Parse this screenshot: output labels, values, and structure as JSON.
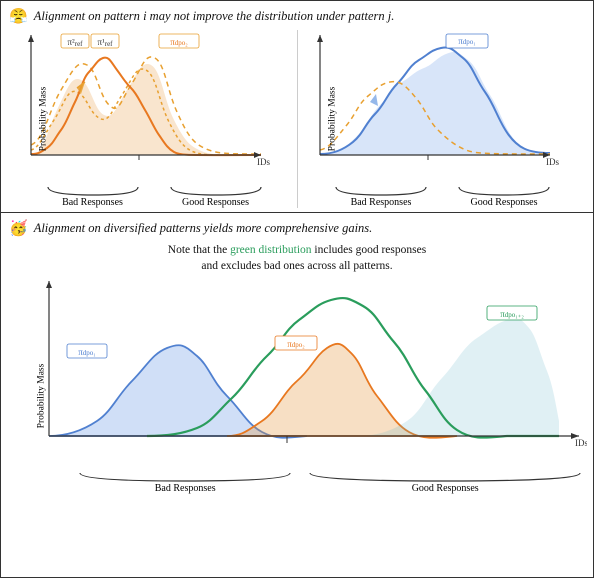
{
  "top_panel": {
    "title": "Alignment on pattern ",
    "title_i": "i",
    "title_mid": " may not improve the distribution under pattern ",
    "title_j": "j",
    "title_end": ".",
    "emoji": "😤"
  },
  "bottom_panel": {
    "title": "Alignment on diversified patterns yields more comprehensive gains.",
    "emoji": "🥳",
    "note_prefix": "Note that the ",
    "note_green": "green distribution",
    "note_suffix": " includes good responses\nand excludes bad ones across all patterns."
  },
  "labels": {
    "bad_responses": "Bad Responses",
    "good_responses": "Good Responses",
    "probability_mass": "Probability Mass",
    "ids": "IDs",
    "pi_ref2": "π²ref",
    "pi_ref1": "π¹ref",
    "pi_dpo2": "πdpo₂",
    "pi_dpo1": "πdpo₁",
    "pi_dpo12": "πdpo₁₊₂"
  }
}
